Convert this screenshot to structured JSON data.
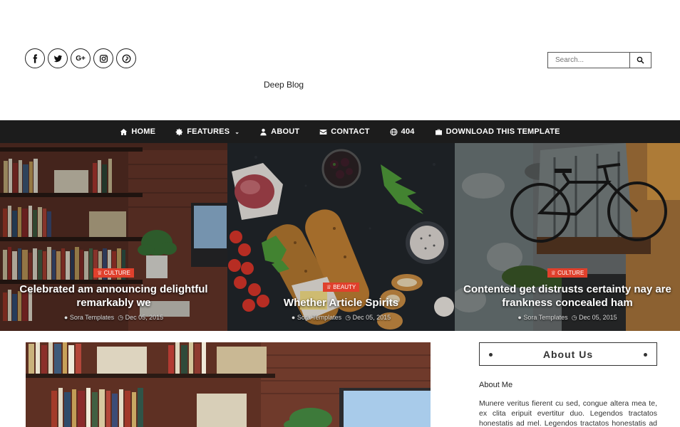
{
  "header": {
    "social_icons": [
      "facebook-icon",
      "twitter-icon",
      "google-plus-icon",
      "instagram-icon",
      "pinterest-icon"
    ],
    "search_placeholder": "Search...",
    "brand": "Deep Blog"
  },
  "nav": {
    "items": [
      {
        "label": "HOME",
        "icon": "home-icon"
      },
      {
        "label": "FEATURES",
        "icon": "gear-icon",
        "dropdown": true
      },
      {
        "label": "ABOUT",
        "icon": "user-icon"
      },
      {
        "label": "CONTACT",
        "icon": "envelope-icon"
      },
      {
        "label": "404",
        "icon": "globe-icon"
      },
      {
        "label": "DOWNLOAD THIS TEMPLATE",
        "icon": "briefcase-icon"
      }
    ]
  },
  "slides": [
    {
      "tag": "CULTURE",
      "title": "Celebrated am announcing delightful remarkably we",
      "author": "Sora Templates",
      "date": "Dec 05, 2015"
    },
    {
      "tag": "BEAUTY",
      "title": "Whether Article Spirits",
      "author": "Sora Templates",
      "date": "Dec 05, 2015"
    },
    {
      "tag": "CULTURE",
      "title": "Contented get distrusts certainty nay are frankness concealed ham",
      "author": "Sora Templates",
      "date": "Dec 05, 2015"
    }
  ],
  "sidebar": {
    "widget_title": "About Us",
    "subtitle": "About Me",
    "text": "Munere veritus fierent cu sed, congue altera mea te, ex clita eripuit evertitur duo. Legendos tractatos honestatis ad mel. Legendos tractatos honestatis ad mel."
  },
  "colors": {
    "nav_bg": "#1c1c1c",
    "tag_bg": "#e0402c"
  }
}
